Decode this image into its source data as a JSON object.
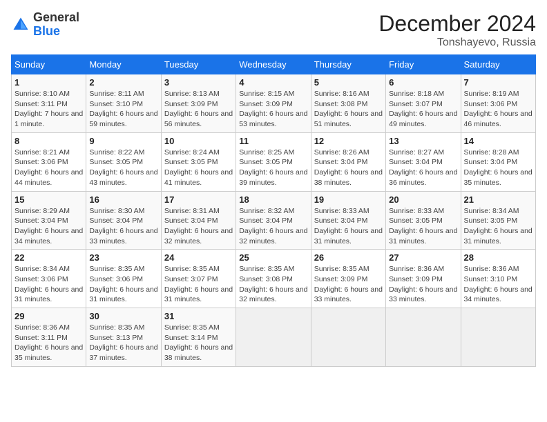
{
  "header": {
    "logo_general": "General",
    "logo_blue": "Blue",
    "month_title": "December 2024",
    "location": "Tonshayevo, Russia"
  },
  "days_of_week": [
    "Sunday",
    "Monday",
    "Tuesday",
    "Wednesday",
    "Thursday",
    "Friday",
    "Saturday"
  ],
  "weeks": [
    [
      {
        "day": "1",
        "sunrise": "Sunrise: 8:10 AM",
        "sunset": "Sunset: 3:11 PM",
        "daylight": "Daylight: 7 hours and 1 minute."
      },
      {
        "day": "2",
        "sunrise": "Sunrise: 8:11 AM",
        "sunset": "Sunset: 3:10 PM",
        "daylight": "Daylight: 6 hours and 59 minutes."
      },
      {
        "day": "3",
        "sunrise": "Sunrise: 8:13 AM",
        "sunset": "Sunset: 3:09 PM",
        "daylight": "Daylight: 6 hours and 56 minutes."
      },
      {
        "day": "4",
        "sunrise": "Sunrise: 8:15 AM",
        "sunset": "Sunset: 3:09 PM",
        "daylight": "Daylight: 6 hours and 53 minutes."
      },
      {
        "day": "5",
        "sunrise": "Sunrise: 8:16 AM",
        "sunset": "Sunset: 3:08 PM",
        "daylight": "Daylight: 6 hours and 51 minutes."
      },
      {
        "day": "6",
        "sunrise": "Sunrise: 8:18 AM",
        "sunset": "Sunset: 3:07 PM",
        "daylight": "Daylight: 6 hours and 49 minutes."
      },
      {
        "day": "7",
        "sunrise": "Sunrise: 8:19 AM",
        "sunset": "Sunset: 3:06 PM",
        "daylight": "Daylight: 6 hours and 46 minutes."
      }
    ],
    [
      {
        "day": "8",
        "sunrise": "Sunrise: 8:21 AM",
        "sunset": "Sunset: 3:06 PM",
        "daylight": "Daylight: 6 hours and 44 minutes."
      },
      {
        "day": "9",
        "sunrise": "Sunrise: 8:22 AM",
        "sunset": "Sunset: 3:05 PM",
        "daylight": "Daylight: 6 hours and 43 minutes."
      },
      {
        "day": "10",
        "sunrise": "Sunrise: 8:24 AM",
        "sunset": "Sunset: 3:05 PM",
        "daylight": "Daylight: 6 hours and 41 minutes."
      },
      {
        "day": "11",
        "sunrise": "Sunrise: 8:25 AM",
        "sunset": "Sunset: 3:05 PM",
        "daylight": "Daylight: 6 hours and 39 minutes."
      },
      {
        "day": "12",
        "sunrise": "Sunrise: 8:26 AM",
        "sunset": "Sunset: 3:04 PM",
        "daylight": "Daylight: 6 hours and 38 minutes."
      },
      {
        "day": "13",
        "sunrise": "Sunrise: 8:27 AM",
        "sunset": "Sunset: 3:04 PM",
        "daylight": "Daylight: 6 hours and 36 minutes."
      },
      {
        "day": "14",
        "sunrise": "Sunrise: 8:28 AM",
        "sunset": "Sunset: 3:04 PM",
        "daylight": "Daylight: 6 hours and 35 minutes."
      }
    ],
    [
      {
        "day": "15",
        "sunrise": "Sunrise: 8:29 AM",
        "sunset": "Sunset: 3:04 PM",
        "daylight": "Daylight: 6 hours and 34 minutes."
      },
      {
        "day": "16",
        "sunrise": "Sunrise: 8:30 AM",
        "sunset": "Sunset: 3:04 PM",
        "daylight": "Daylight: 6 hours and 33 minutes."
      },
      {
        "day": "17",
        "sunrise": "Sunrise: 8:31 AM",
        "sunset": "Sunset: 3:04 PM",
        "daylight": "Daylight: 6 hours and 32 minutes."
      },
      {
        "day": "18",
        "sunrise": "Sunrise: 8:32 AM",
        "sunset": "Sunset: 3:04 PM",
        "daylight": "Daylight: 6 hours and 32 minutes."
      },
      {
        "day": "19",
        "sunrise": "Sunrise: 8:33 AM",
        "sunset": "Sunset: 3:04 PM",
        "daylight": "Daylight: 6 hours and 31 minutes."
      },
      {
        "day": "20",
        "sunrise": "Sunrise: 8:33 AM",
        "sunset": "Sunset: 3:05 PM",
        "daylight": "Daylight: 6 hours and 31 minutes."
      },
      {
        "day": "21",
        "sunrise": "Sunrise: 8:34 AM",
        "sunset": "Sunset: 3:05 PM",
        "daylight": "Daylight: 6 hours and 31 minutes."
      }
    ],
    [
      {
        "day": "22",
        "sunrise": "Sunrise: 8:34 AM",
        "sunset": "Sunset: 3:06 PM",
        "daylight": "Daylight: 6 hours and 31 minutes."
      },
      {
        "day": "23",
        "sunrise": "Sunrise: 8:35 AM",
        "sunset": "Sunset: 3:06 PM",
        "daylight": "Daylight: 6 hours and 31 minutes."
      },
      {
        "day": "24",
        "sunrise": "Sunrise: 8:35 AM",
        "sunset": "Sunset: 3:07 PM",
        "daylight": "Daylight: 6 hours and 31 minutes."
      },
      {
        "day": "25",
        "sunrise": "Sunrise: 8:35 AM",
        "sunset": "Sunset: 3:08 PM",
        "daylight": "Daylight: 6 hours and 32 minutes."
      },
      {
        "day": "26",
        "sunrise": "Sunrise: 8:35 AM",
        "sunset": "Sunset: 3:09 PM",
        "daylight": "Daylight: 6 hours and 33 minutes."
      },
      {
        "day": "27",
        "sunrise": "Sunrise: 8:36 AM",
        "sunset": "Sunset: 3:09 PM",
        "daylight": "Daylight: 6 hours and 33 minutes."
      },
      {
        "day": "28",
        "sunrise": "Sunrise: 8:36 AM",
        "sunset": "Sunset: 3:10 PM",
        "daylight": "Daylight: 6 hours and 34 minutes."
      }
    ],
    [
      {
        "day": "29",
        "sunrise": "Sunrise: 8:36 AM",
        "sunset": "Sunset: 3:11 PM",
        "daylight": "Daylight: 6 hours and 35 minutes."
      },
      {
        "day": "30",
        "sunrise": "Sunrise: 8:35 AM",
        "sunset": "Sunset: 3:13 PM",
        "daylight": "Daylight: 6 hours and 37 minutes."
      },
      {
        "day": "31",
        "sunrise": "Sunrise: 8:35 AM",
        "sunset": "Sunset: 3:14 PM",
        "daylight": "Daylight: 6 hours and 38 minutes."
      },
      null,
      null,
      null,
      null
    ]
  ]
}
